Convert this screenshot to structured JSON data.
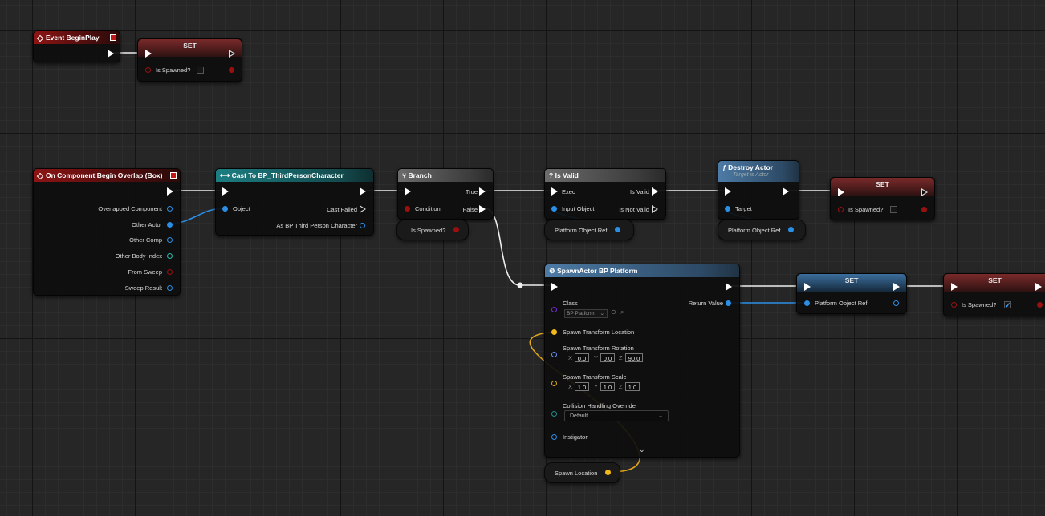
{
  "nodes": {
    "event_begin_play": {
      "title": "Event BeginPlay"
    },
    "set_top": {
      "title": "SET",
      "var_label": "Is Spawned?",
      "checked": false
    },
    "on_overlap": {
      "title": "On Component Begin Overlap (Box)",
      "outputs": [
        "Overlapped Component",
        "Other Actor",
        "Other Comp",
        "Other Body Index",
        "From Sweep",
        "Sweep Result"
      ]
    },
    "cast": {
      "title": "Cast To BP_ThirdPersonCharacter",
      "input": "Object",
      "cast_failed": "Cast Failed",
      "as_output": "As BP Third Person Character"
    },
    "branch": {
      "title": "Branch",
      "condition": "Condition",
      "true_label": "True",
      "false_label": "False"
    },
    "is_spawned_getter": {
      "label": "Is Spawned?"
    },
    "is_valid": {
      "title": "Is Valid",
      "exec": "Exec",
      "input": "Input Object",
      "valid": "Is Valid",
      "not_valid": "Is Not Valid"
    },
    "platform_ref_getter_1": {
      "label": "Platform Object Ref"
    },
    "destroy_actor": {
      "title": "Destroy Actor",
      "subtitle": "Target is Actor",
      "target": "Target"
    },
    "platform_ref_getter_2": {
      "label": "Platform Object Ref"
    },
    "set_mid": {
      "title": "SET",
      "var_label": "Is Spawned?",
      "checked": false
    },
    "spawn_actor": {
      "title": "SpawnActor BP Platform",
      "class_label": "Class",
      "class_value": "BP Platform",
      "return_value": "Return Value",
      "loc_label": "Spawn Transform Location",
      "rot_label": "Spawn Transform Rotation",
      "rot": {
        "x": "0.0",
        "y": "0.0",
        "z": "90.0"
      },
      "scale_label": "Spawn Transform Scale",
      "scale": {
        "x": "1.0",
        "y": "1.0",
        "z": "1.0"
      },
      "collision_label": "Collision Handling Override",
      "collision_value": "Default",
      "instigator": "Instigator",
      "axis_x": "X",
      "axis_y": "Y",
      "axis_z": "Z"
    },
    "set_platform": {
      "title": "SET",
      "var_label": "Platform Object Ref"
    },
    "set_right": {
      "title": "SET",
      "var_label": "Is Spawned?",
      "checked": true
    },
    "spawn_location_getter": {
      "label": "Spawn Location"
    }
  },
  "icons": {
    "function": "ƒ",
    "question": "?",
    "cast": "⟷",
    "branch": "⑂",
    "spawn": "⚙"
  },
  "colors": {
    "exec": "#ffffff",
    "object_pin": "#2a8fe6",
    "bool_pin": "#9a1010",
    "vector_pin": "#f0b818",
    "event_header": "#8d1414",
    "cast_header": "#1c7e82",
    "function_header": "#4d7ba6"
  }
}
